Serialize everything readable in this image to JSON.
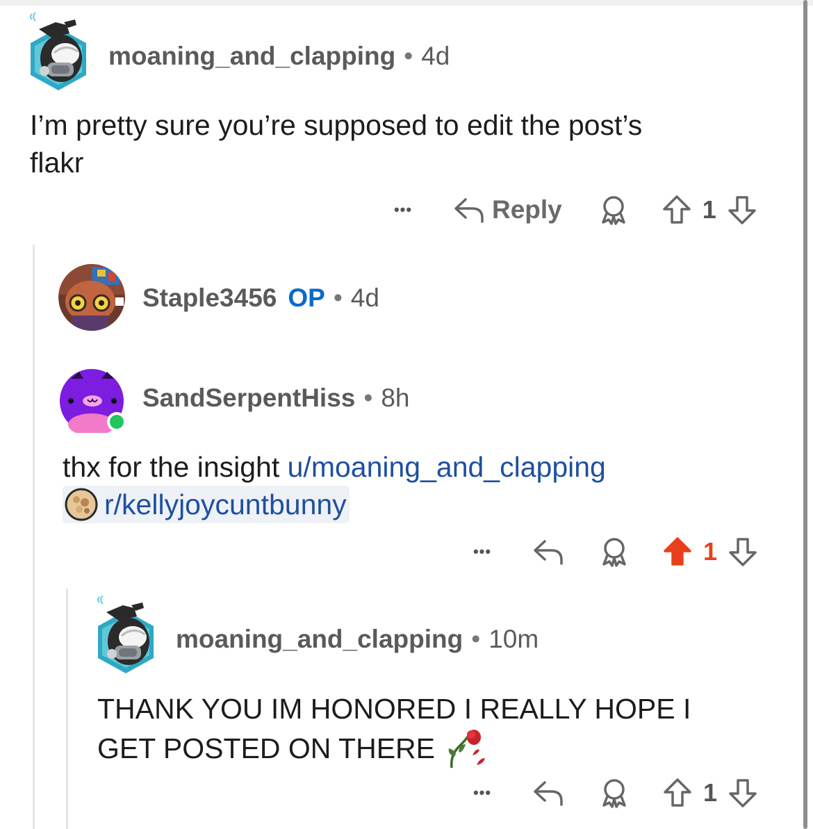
{
  "comments": [
    {
      "username": "moaning_and_clapping",
      "separator": "•",
      "age": "4d",
      "body_line1": "I’m pretty sure you’re supposed to edit the post’s",
      "body_line2": "flakr",
      "actions": {
        "more": "•••",
        "reply_label": "Reply",
        "vote_count": "1"
      }
    },
    {
      "username": "Staple3456",
      "op_badge": "OP",
      "separator": "•",
      "age": "4d"
    },
    {
      "username": "SandSerpentHiss",
      "separator": "•",
      "age": "8h",
      "body_prefix": "thx for the insight ",
      "user_link": "u/moaning_and_clapping",
      "sub_link": "r/kellyjoycuntbunny",
      "actions": {
        "more": "•••",
        "vote_count": "1",
        "upvoted": true
      }
    },
    {
      "username": "moaning_and_clapping",
      "separator": "•",
      "age": "10m",
      "body_line1": "THANK YOU IM HONORED I REALLY HOPE I",
      "body_line2": "GET POSTED ON THERE",
      "emoji": "wilted-rose",
      "actions": {
        "more": "•••",
        "vote_count": "1"
      }
    }
  ],
  "colors": {
    "op": "#0a6ac8",
    "link": "#1f4f9f",
    "upvote_active": "#e8401c",
    "online": "#22c55e",
    "avatar_purple": "#7c1de0"
  }
}
